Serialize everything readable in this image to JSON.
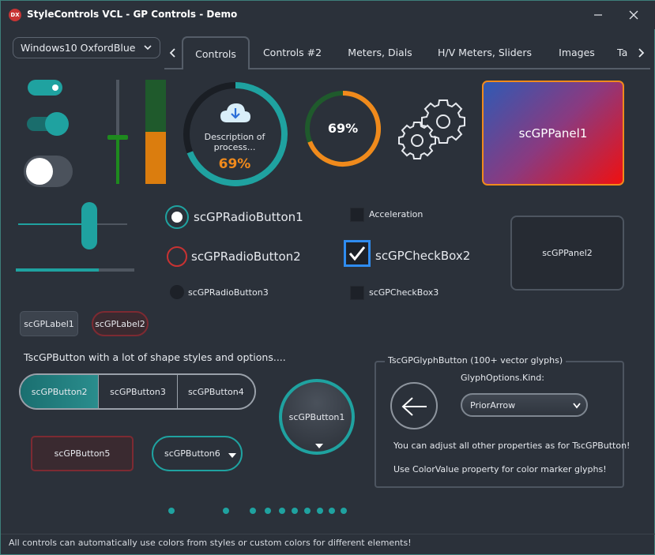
{
  "window": {
    "app_icon": "DX",
    "title": "StyleControls VCL - GP Controls - Demo",
    "minimize_icon": "minimize-icon",
    "close_icon": "close-icon"
  },
  "style_combo": {
    "value": "Windows10 OxfordBlue"
  },
  "tabs": [
    {
      "label": "Controls",
      "active": true
    },
    {
      "label": "Controls #2",
      "active": false
    },
    {
      "label": "Meters, Dials",
      "active": false
    },
    {
      "label": "H/V Meters, Sliders",
      "active": false
    },
    {
      "label": "Images",
      "active": false
    },
    {
      "label": "Ta",
      "active": false
    }
  ],
  "progress_dial": {
    "description": "Description of process...",
    "value_text": "69%",
    "value": 0.69
  },
  "small_meter": {
    "value_text": "69%",
    "value": 0.69
  },
  "panel1": {
    "label": "scGPPanel1"
  },
  "panel2": {
    "label": "scGPPanel2"
  },
  "radios": [
    {
      "label": "scGPRadioButton1",
      "checked": true
    },
    {
      "label": "scGPRadioButton2",
      "checked": false
    },
    {
      "label": "scGPRadioButton3",
      "checked": false
    }
  ],
  "checkboxes": [
    {
      "label": "Acceleration",
      "checked": false
    },
    {
      "label": "scGPCheckBox2",
      "checked": true
    },
    {
      "label": "scGPCheckBox3",
      "checked": false
    }
  ],
  "labels": {
    "label1": "scGPLabel1",
    "label2": "scGPLabel2"
  },
  "button_section": {
    "heading": "TscGPButton with a lot of shape styles and options....",
    "segmented": [
      "scGPButton2",
      "scGPButton3",
      "scGPButton4"
    ],
    "button1": "scGPButton1",
    "button5": "scGPButton5",
    "button6": "scGPButton6"
  },
  "glyph_group": {
    "title": "TscGPGlyphButton (100+ vector glyphs)",
    "kind_label": "GlyphOptions.Kind:",
    "kind_value": "PriorArrow",
    "note1": "You can adjust all other properties as for TscGPButton!",
    "note2": "Use ColorValue property for color marker glyphs!"
  },
  "status": {
    "text": "All controls can automatically use colors from styles or custom colors for different elements!"
  },
  "colors": {
    "accent": "#1fa2a0",
    "orange": "#f08a1c",
    "red": "#c83232",
    "green": "#1e7d1e"
  },
  "vertical_slider": {
    "value": 0.45
  },
  "level_bar": {
    "value": 0.5
  },
  "horizontal_slider": {
    "value": 0.65
  },
  "progress_bar": {
    "value": 0.7
  }
}
